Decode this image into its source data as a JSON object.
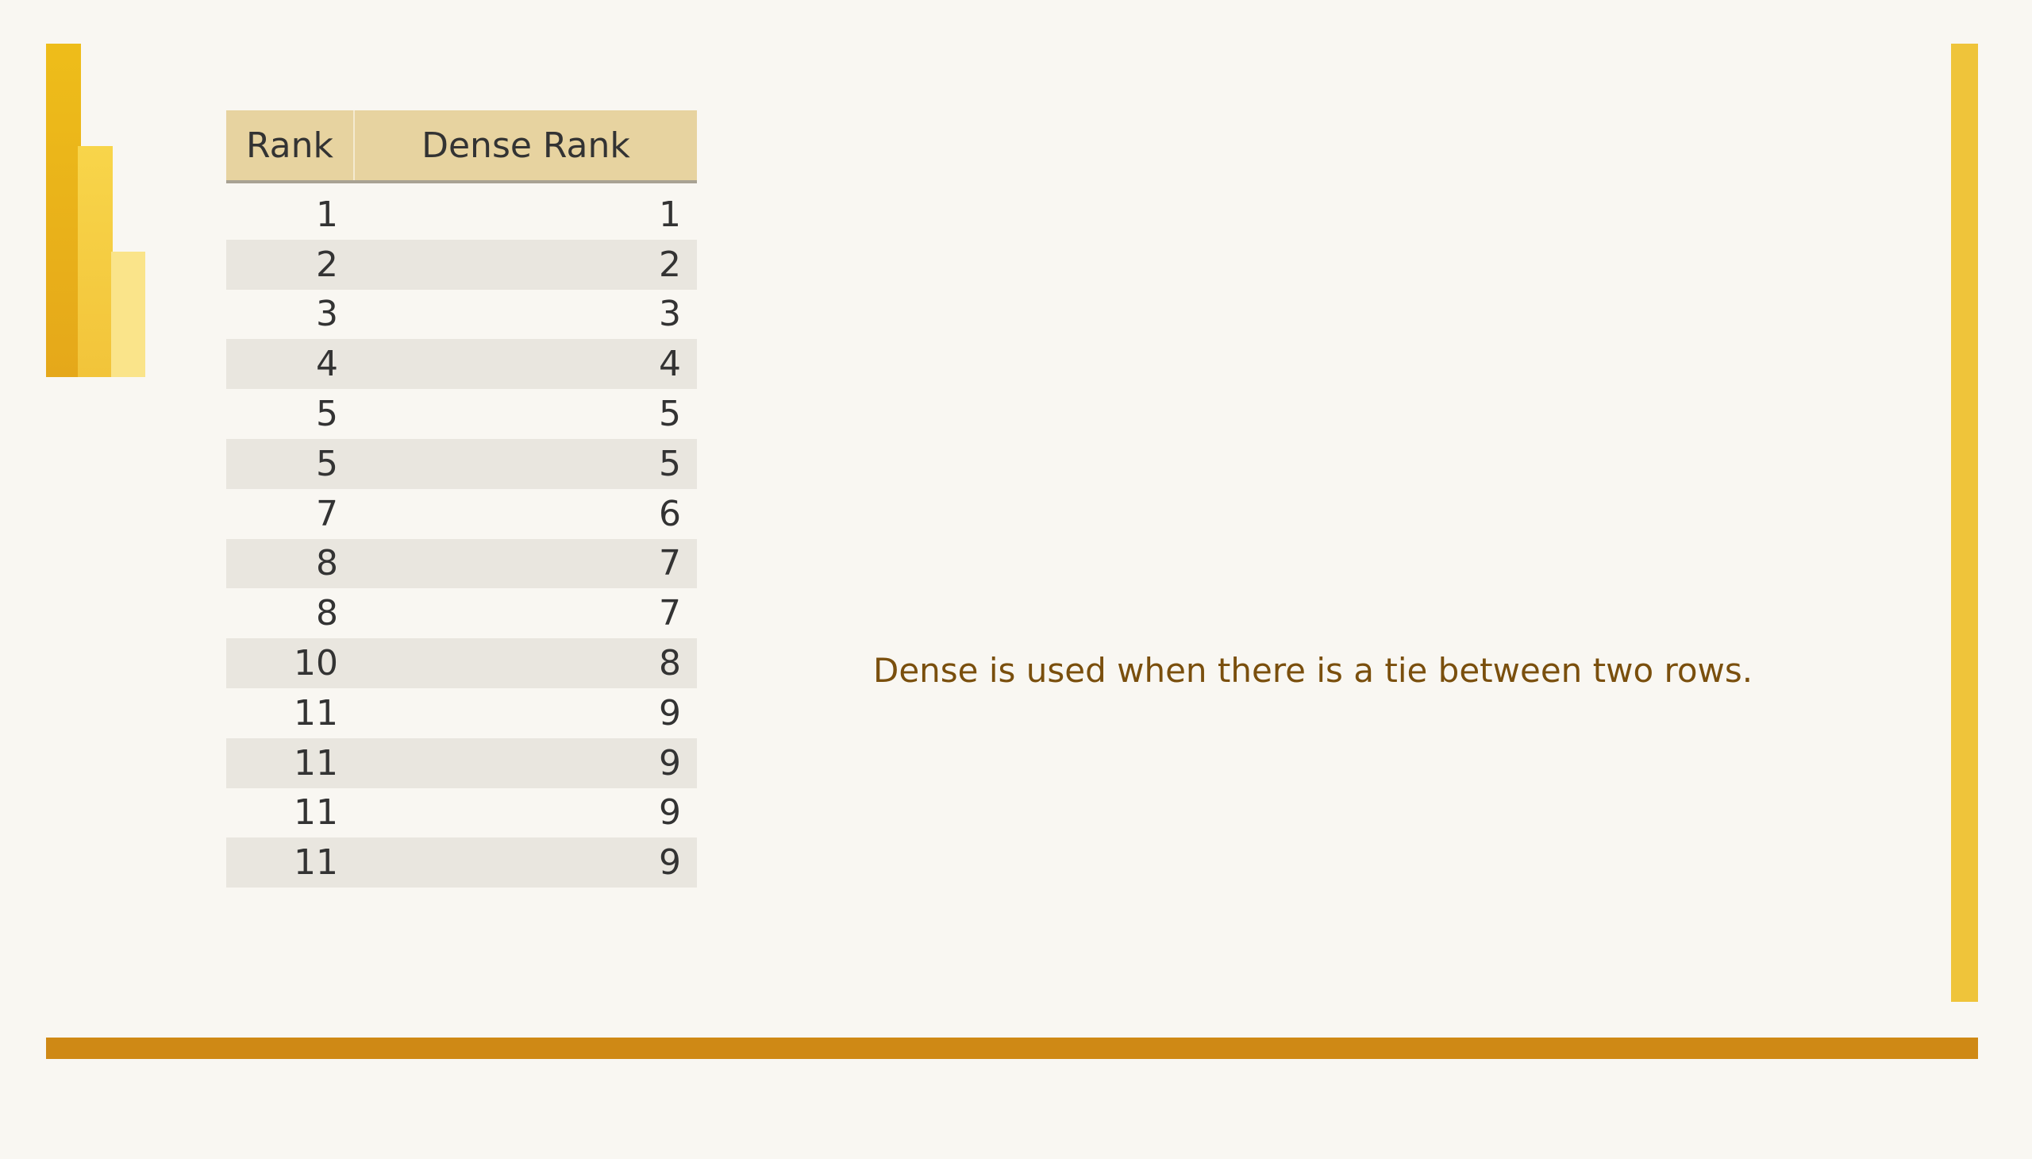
{
  "table": {
    "headers": [
      "Rank",
      "Dense Rank"
    ],
    "rows": [
      [
        "1",
        "1"
      ],
      [
        "2",
        "2"
      ],
      [
        "3",
        "3"
      ],
      [
        "4",
        "4"
      ],
      [
        "5",
        "5"
      ],
      [
        "5",
        "5"
      ],
      [
        "7",
        "6"
      ],
      [
        "8",
        "7"
      ],
      [
        "8",
        "7"
      ],
      [
        "10",
        "8"
      ],
      [
        "11",
        "9"
      ],
      [
        "11",
        "9"
      ],
      [
        "11",
        "9"
      ],
      [
        "11",
        "9"
      ]
    ]
  },
  "note": "Dense is used when there is a tie between two rows.",
  "colors": {
    "header_bg": "#e7d3a0",
    "stripe_bg": "#e9e6df",
    "accent_right": "#efc43a",
    "accent_bottom": "#cf8915",
    "note_text": "#7a4f0d"
  }
}
